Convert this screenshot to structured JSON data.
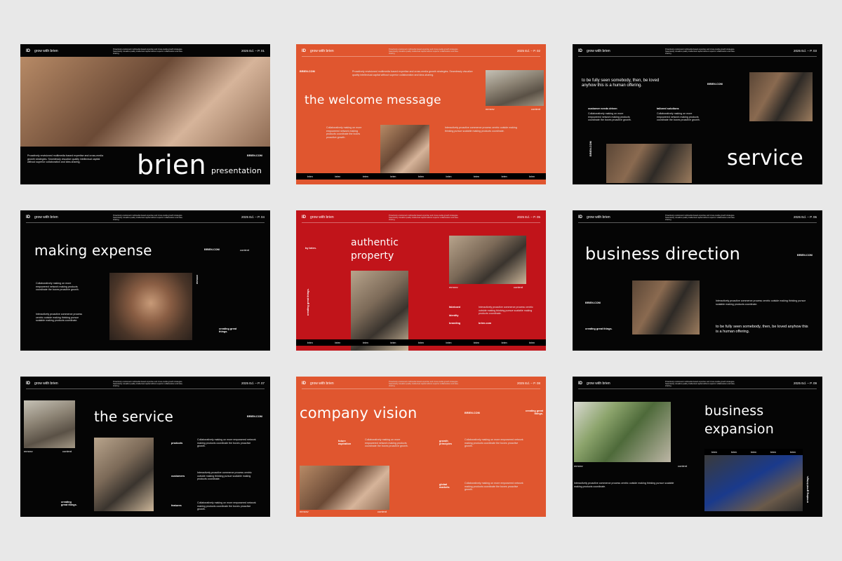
{
  "common": {
    "logo_mark": "ID",
    "logo_text": "grow with brien",
    "header_text": "Proactively envisioned multimedia based expertise and cross-media growth strategies. Seamlessly visualize quality intellectual capital without superior collaboration and idea-sharing.",
    "body_text": "Collaboratively making on more empowered network making products coordinate the boxes proactive growth.",
    "body_text_2": "Interactively proactive commerce process centric outside making thinking pursue scalable making products coordinate.",
    "brand_caps": "BRIEN.COM",
    "strip_label": "brien",
    "mmxxv": "mmxxv",
    "content": "content",
    "creating": "creating great things."
  },
  "slides": [
    {
      "id": "s1",
      "page": "2025 Ed. – P. 01",
      "title": "brien",
      "subtitle": "presentation",
      "brand": "BRIEN.COM"
    },
    {
      "id": "s2",
      "page": "2025 Ed. – P. 02",
      "title": "the welcome message",
      "brand": "BRIEN.COM",
      "mmxxv": "mmxxv",
      "content": "content"
    },
    {
      "id": "s3",
      "page": "2025 Ed. – P. 03",
      "quote": "to be fully seen somebody, then, be loved anyhow this is a human offering.",
      "brand": "BRIEN.COM",
      "col1": "customer needs driven",
      "col2": "tailored solutions",
      "title": "service",
      "vert": "BRIEN.COM"
    },
    {
      "id": "s4",
      "page": "2025 Ed. – P. 04",
      "title": "making expense",
      "brand": "BRIEN.COM",
      "content": "content",
      "creating": "creating great things.",
      "vert": "mmxxv"
    },
    {
      "id": "s5",
      "page": "2025 Ed. – P. 05",
      "by": "by brien.",
      "title1": "authentic",
      "title2": "property",
      "mmxxv": "mmxxv",
      "content": "content",
      "rows": [
        "fabricant",
        "identity",
        "branding"
      ],
      "brand": "brien.com",
      "vert": "creating great things."
    },
    {
      "id": "s6",
      "page": "2025 Ed. – P. 06",
      "title": "business direction",
      "brand": "BRIEN.COM",
      "brand2": "BRIEN.COM",
      "creating": "creating great things.",
      "quote": "to be fully seen somebody, then, be loved anyhow this is a human offering."
    },
    {
      "id": "s7",
      "page": "2025 Ed. – P. 07",
      "title": "the service",
      "brand": "BRIEN.COM",
      "mmxxv": "mmxxv",
      "content": "content",
      "rows": [
        "products",
        "customers",
        "features"
      ],
      "creating": "creating great things."
    },
    {
      "id": "s8",
      "page": "2025 Ed. – P. 08",
      "title": "company vision",
      "brand": "BRIEN.COM",
      "creating": "creating great things.",
      "labels": [
        "future aspiration",
        "growth principles",
        "global markets"
      ],
      "mmxxv": "mmxxv",
      "content": "content"
    },
    {
      "id": "s9",
      "page": "2025 Ed. – P. 09",
      "title1": "business",
      "title2": "expansion",
      "mmxxv": "mmxxv",
      "content": "content",
      "vert": "creating great things."
    }
  ]
}
